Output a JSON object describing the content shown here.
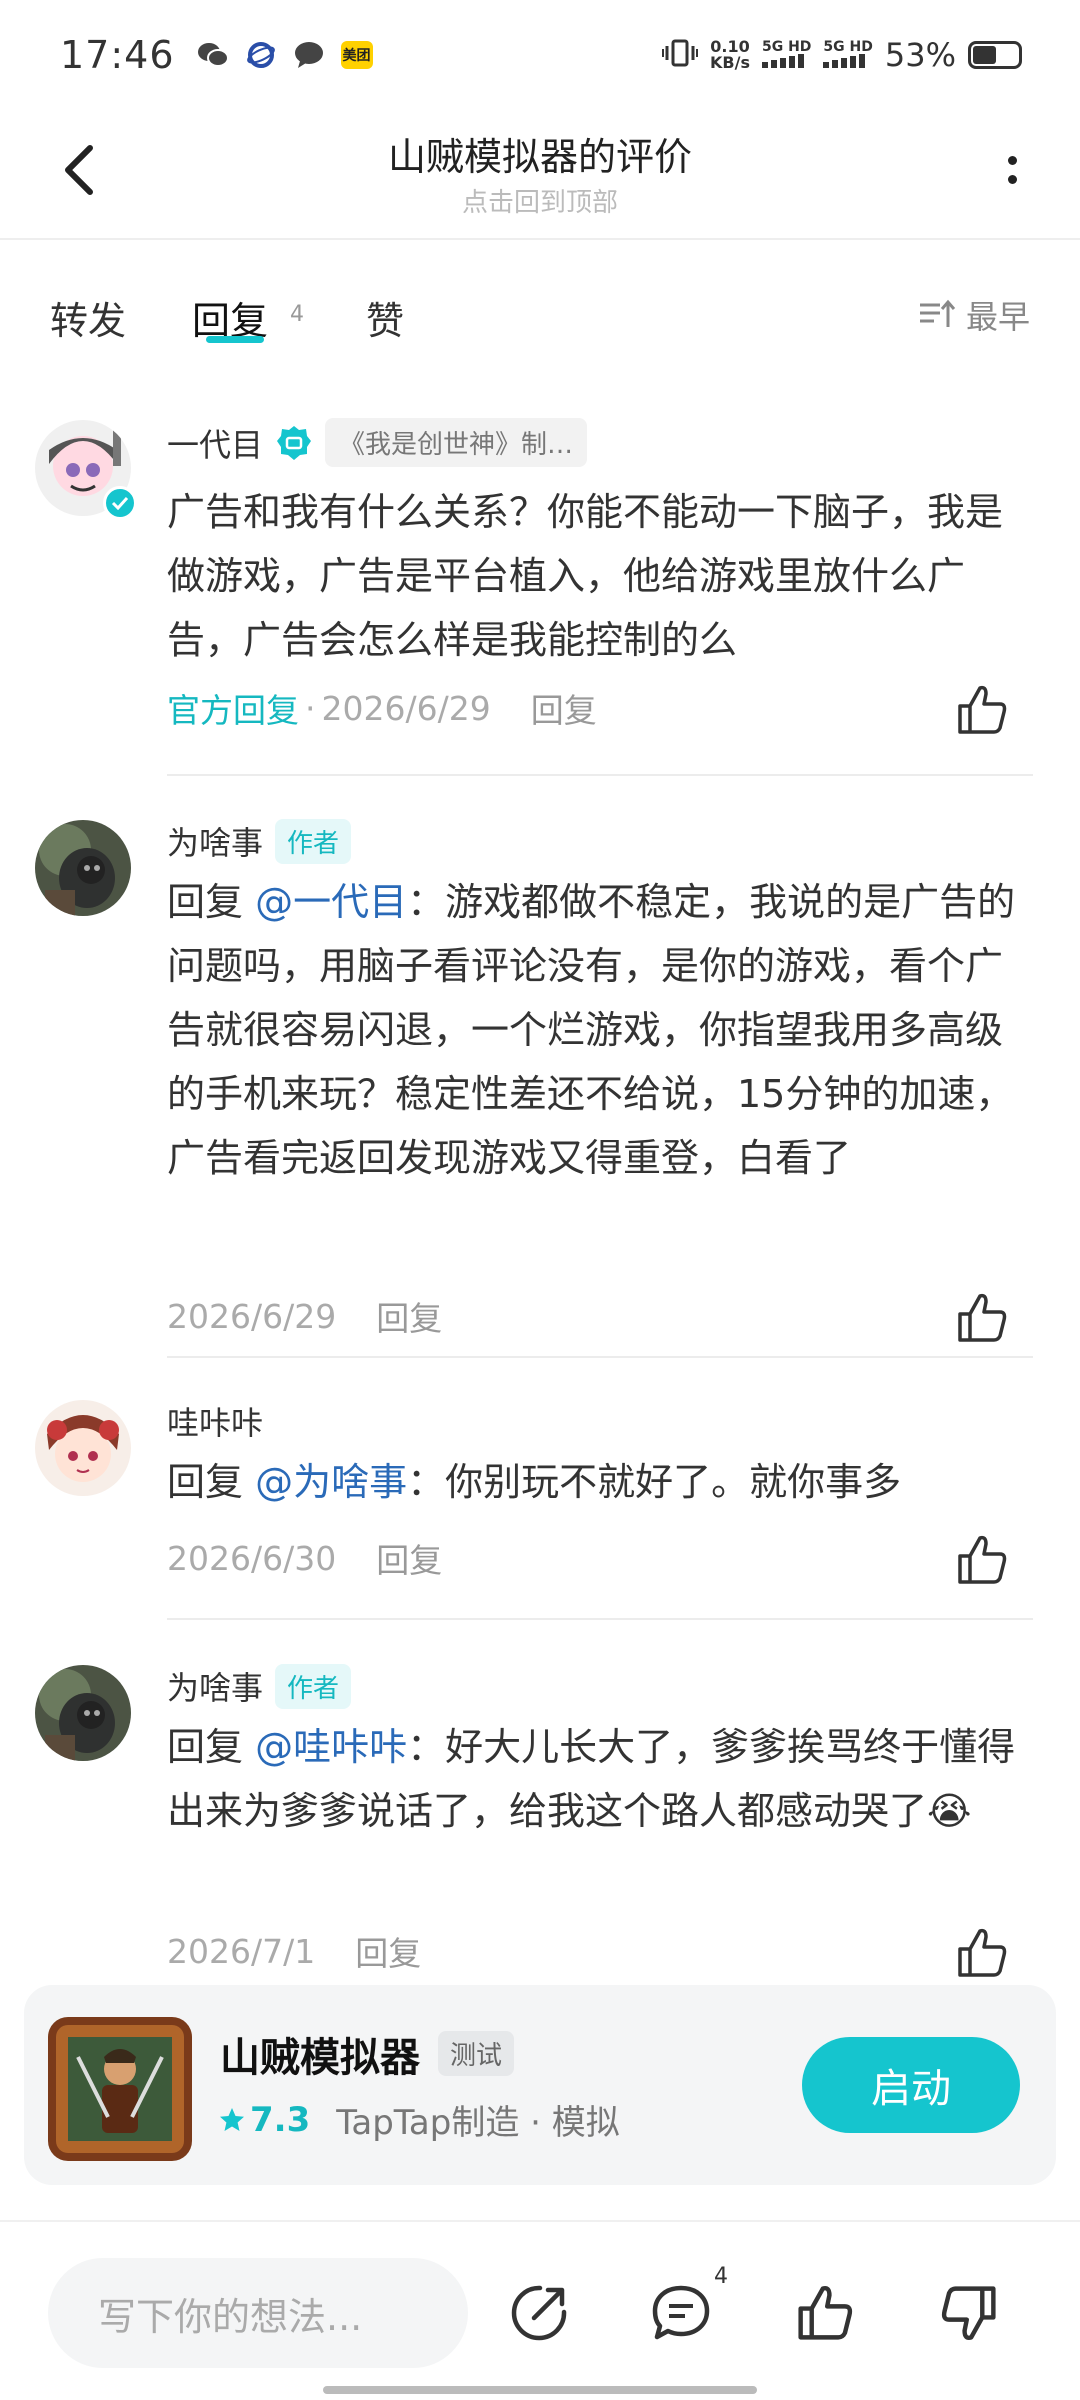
{
  "status_bar": {
    "time": "17:46",
    "net_speed_value": "0.10",
    "net_speed_unit": "KB/s",
    "sim1": "5G HD",
    "sim2": "5G HD",
    "battery": "53%",
    "battery_level": 0.53
  },
  "nav": {
    "title": "山贼模拟器的评价",
    "subtitle": "点击回到顶部"
  },
  "tabs": {
    "items": [
      {
        "label": "转发"
      },
      {
        "label": "回复",
        "count": "4"
      },
      {
        "label": "赞"
      }
    ],
    "active_index": 1,
    "sort_label": "最早"
  },
  "comments": [
    {
      "name": "一代目",
      "game_tag": "《我是创世神》制…",
      "text": "广告和我有什么关系？你能不能动一下脑子，我是做游戏，广告是平台植入，他给游戏里放什么广告，广告会怎么样是我能控制的么",
      "official_reply": "官方回复",
      "date": "2026/6/29",
      "reply_label": "回复"
    },
    {
      "name": "为啥事",
      "author_tag": "作者",
      "reply_prefix": "回复",
      "mention": "@一代目",
      "text": "：游戏都做不稳定，我说的是广告的问题吗，用脑子看评论没有，是你的游戏，看个广告就很容易闪退，一个烂游戏，你指望我用多高级的手机来玩？稳定性差还不给说，15分钟的加速，广告看完返回发现游戏又得重登，白看了",
      "date": "2026/6/29",
      "reply_label": "回复"
    },
    {
      "name": "哇咔咔",
      "reply_prefix": "回复",
      "mention": "@为啥事",
      "text": "：你别玩不就好了。就你事多",
      "date": "2026/6/30",
      "reply_label": "回复"
    },
    {
      "name": "为啥事",
      "author_tag": "作者",
      "reply_prefix": "回复",
      "mention": "@哇咔咔",
      "text": "：好大儿长大了，爹爹挨骂终于懂得出来为爹爹说话了，给我这个路人都感动哭了😭",
      "date": "2026/7/1",
      "reply_label": "回复"
    }
  ],
  "game_card": {
    "name": "山贼模拟器",
    "test_tag": "测试",
    "rating": "7.3",
    "maker": "TapTap制造 · 模拟",
    "launch_label": "启动"
  },
  "bottom_bar": {
    "input_placeholder": "写下你的想法...",
    "comment_count": "4"
  },
  "colors": {
    "accent": "#15c5ce",
    "mention": "#2a6ab8"
  }
}
